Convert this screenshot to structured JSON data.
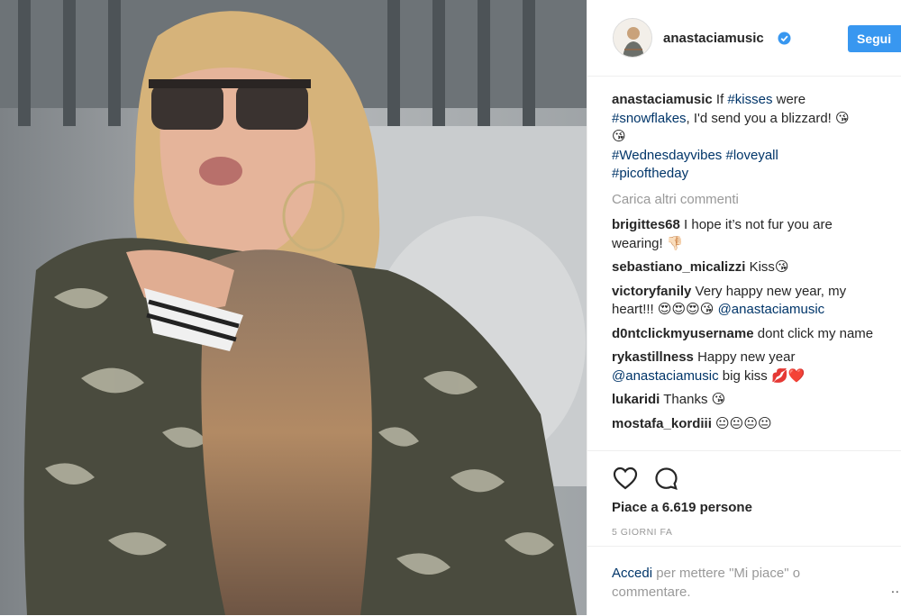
{
  "post": {
    "username": "anastaciamusic",
    "follow_label": "Segui",
    "verified_icon": "verified-badge-icon",
    "avatar_icon": "profile-avatar",
    "photo_icon": "woman-blowing-kiss-photo"
  },
  "caption": {
    "user": "anastaciamusic",
    "t1": "If ",
    "h1": "#kisses",
    "t2": " were",
    "h2": "#snowflakes",
    "t3": ", I'd send you a blizzard! 😘",
    "t4": "😘",
    "h3": "#Wednesdayvibes",
    "h4": "#loveyall",
    "h5": "#picoftheday"
  },
  "load_more": "Carica altri commenti",
  "comments": [
    {
      "user": "brigittes68",
      "text": "I hope it’s not fur you are wearing! 👎🏻"
    },
    {
      "user": "sebastiano_micalizzi",
      "text": "Kiss😘"
    },
    {
      "user": "victoryfanily",
      "text": "Very happy new year, my heart!!! 😍😍😍😘 ",
      "mention": "@anastaciamusic"
    },
    {
      "user": "d0ntclickmyusername",
      "text": "dont click my name"
    },
    {
      "user": "rykastillness",
      "text": "Happy new year ",
      "mention": "@anastaciamusic",
      "text2": " big kiss 💋❤️"
    },
    {
      "user": "lukaridi",
      "text": "Thanks 😘"
    },
    {
      "user": "mostafa_kordiii",
      "text": "😐😐😐😐"
    }
  ],
  "actions": {
    "like_icon": "heart-icon",
    "comment_icon": "comment-bubble-icon",
    "likes": "Piace a 6.619 persone",
    "time": "5 GIORNI FA"
  },
  "login": {
    "link": "Accedi",
    "text": " per mettere \"Mi piace\" o commentare.",
    "more": "..."
  },
  "colors": {
    "accent": "#3897f0",
    "link": "#003569",
    "muted": "#999999"
  }
}
